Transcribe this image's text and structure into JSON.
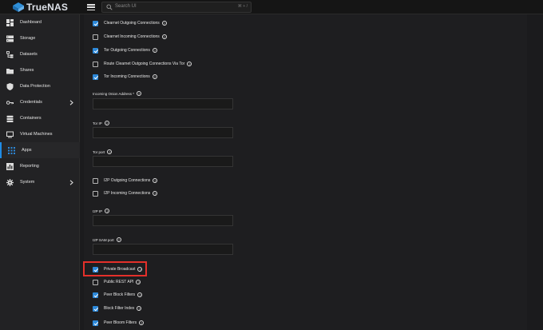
{
  "topbar": {
    "brand": "TrueNAS",
    "search_placeholder": "Search UI",
    "search_shortcut": "⌘ + /"
  },
  "sidebar": {
    "items": [
      {
        "label": "Dashboard",
        "icon": "dashboard-icon"
      },
      {
        "label": "Storage",
        "icon": "storage-icon"
      },
      {
        "label": "Datasets",
        "icon": "datasets-icon"
      },
      {
        "label": "Shares",
        "icon": "shares-icon"
      },
      {
        "label": "Data Protection",
        "icon": "shield-icon"
      },
      {
        "label": "Credentials",
        "icon": "key-icon",
        "has_children": true
      },
      {
        "label": "Containers",
        "icon": "containers-icon"
      },
      {
        "label": "Virtual Machines",
        "icon": "monitor-icon"
      },
      {
        "label": "Apps",
        "icon": "apps-grid-icon",
        "active": true
      },
      {
        "label": "Reporting",
        "icon": "reporting-icon"
      },
      {
        "label": "System",
        "icon": "gear-icon",
        "has_children": true
      }
    ]
  },
  "form": {
    "clearnet_outgoing": {
      "label": "Clearnet Outgoing Connections",
      "checked": true
    },
    "clearnet_incoming": {
      "label": "Clearnet Incoming Connections",
      "checked": false
    },
    "tor_outgoing": {
      "label": "Tor Outgoing Connections",
      "checked": true
    },
    "route_clearnet_via_tor": {
      "label": "Route Clearnet Outgoing Connections Via Tor",
      "checked": false
    },
    "tor_incoming": {
      "label": "Tor Incoming Connections",
      "checked": true
    },
    "incoming_tor_address": {
      "label": "Incoming Onion Address *",
      "value": ""
    },
    "tor_ip": {
      "label": "Tor IP",
      "value": ""
    },
    "tor_port": {
      "label": "Tor port",
      "value": ""
    },
    "i2p_outgoing": {
      "label": "I2P Outgoing Connections",
      "checked": false
    },
    "i2p_incoming": {
      "label": "I2P Incoming Connections",
      "checked": false
    },
    "i2p_ip": {
      "label": "I2P IP",
      "value": ""
    },
    "i2p_sam_port": {
      "label": "I2P SAM port",
      "value": ""
    },
    "private_broadcast": {
      "label": "Private Broadcast",
      "checked": true
    },
    "public_rest_api": {
      "label": "Public REST API",
      "checked": false
    },
    "peer_block_filters": {
      "label": "Peer Block Filters",
      "checked": true
    },
    "block_filter_index": {
      "label": "Block Filter Index",
      "checked": true
    },
    "peer_bloom_filters": {
      "label": "Peer Bloom Filters",
      "checked": true
    }
  },
  "colors": {
    "accent": "#2c88d9",
    "highlight": "#e4302a"
  }
}
